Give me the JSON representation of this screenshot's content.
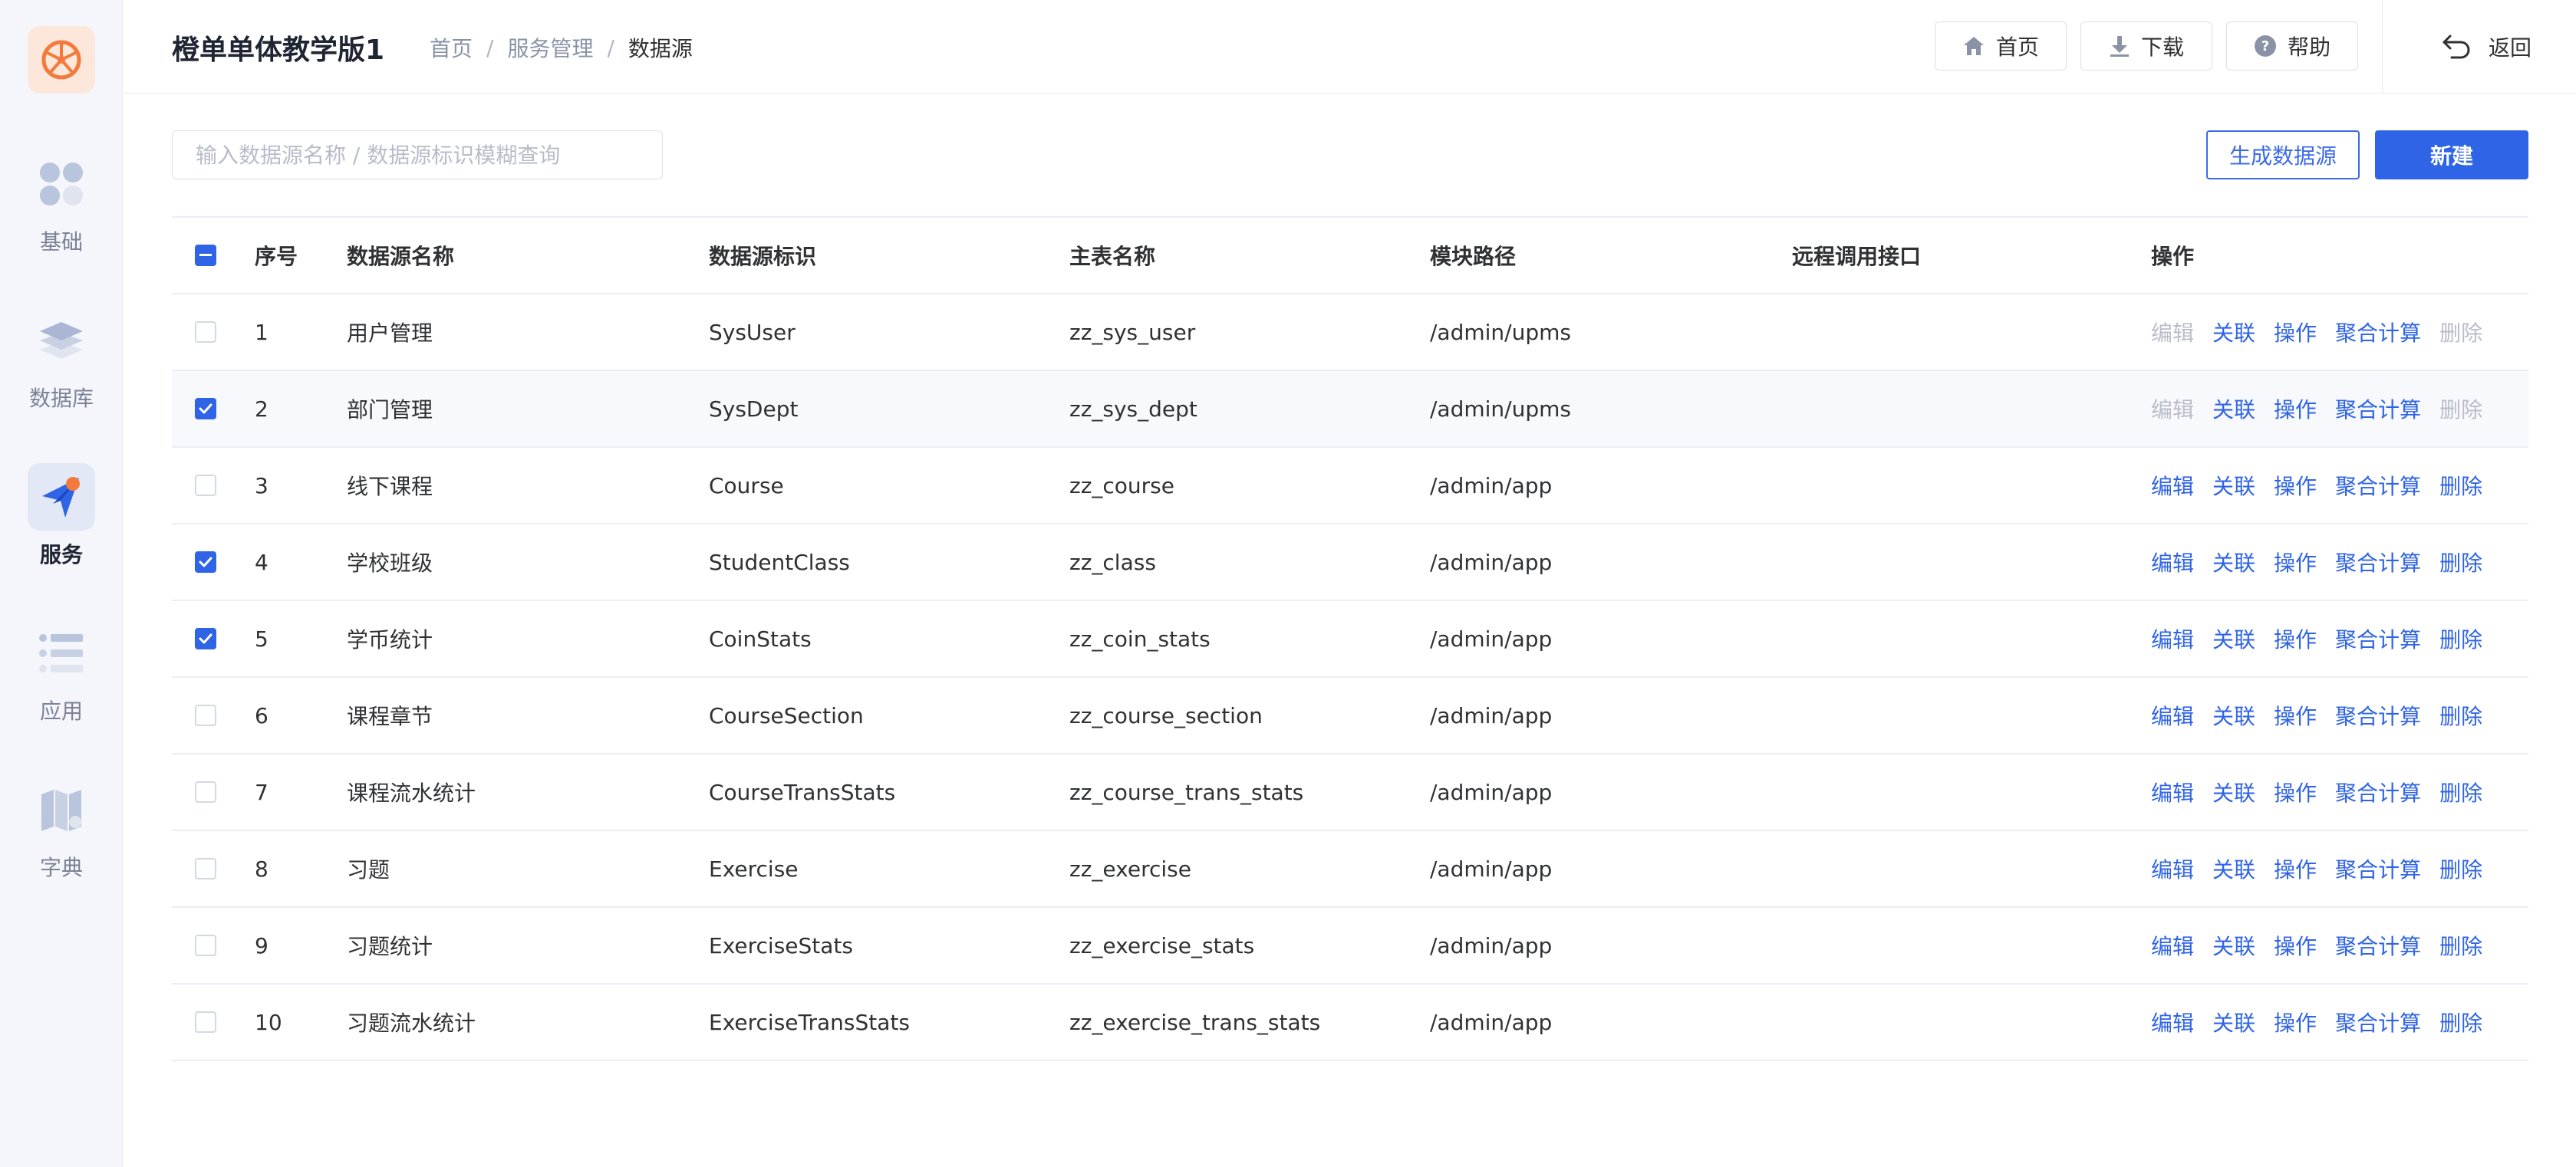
{
  "app": {
    "title": "橙单单体教学版1"
  },
  "breadcrumb": {
    "items": [
      "首页",
      "服务管理"
    ],
    "current": "数据源",
    "separator": "/"
  },
  "header": {
    "home_label": "首页",
    "download_label": "下载",
    "help_label": "帮助",
    "back_label": "返回"
  },
  "sidebar": {
    "items": [
      {
        "label": "基础",
        "icon": "apps-icon",
        "active": false
      },
      {
        "label": "数据库",
        "icon": "layers-icon",
        "active": false
      },
      {
        "label": "服务",
        "icon": "send-icon",
        "active": true
      },
      {
        "label": "应用",
        "icon": "list-icon",
        "active": false
      },
      {
        "label": "字典",
        "icon": "book-icon",
        "active": false
      }
    ]
  },
  "toolbar": {
    "search_placeholder": "输入数据源名称 / 数据源标识模糊查询",
    "search_value": "",
    "generate_label": "生成数据源",
    "new_label": "新建"
  },
  "table": {
    "columns": [
      "序号",
      "数据源名称",
      "数据源标识",
      "主表名称",
      "模块路径",
      "远程调用接口",
      "操作"
    ],
    "header_checkbox": "indeterminate",
    "operations": [
      "编辑",
      "关联",
      "操作",
      "聚合计算",
      "删除"
    ],
    "rows": [
      {
        "index": "1",
        "name": "用户管理",
        "variable": "SysUser",
        "main_table": "zz_sys_user",
        "path": "/admin/upms",
        "rpc": "",
        "checked": false,
        "edit_disabled": true,
        "delete_disabled": true
      },
      {
        "index": "2",
        "name": "部门管理",
        "variable": "SysDept",
        "main_table": "zz_sys_dept",
        "path": "/admin/upms",
        "rpc": "",
        "checked": true,
        "edit_disabled": true,
        "delete_disabled": true
      },
      {
        "index": "3",
        "name": "线下课程",
        "variable": "Course",
        "main_table": "zz_course",
        "path": "/admin/app",
        "rpc": "",
        "checked": false,
        "edit_disabled": false,
        "delete_disabled": false
      },
      {
        "index": "4",
        "name": "学校班级",
        "variable": "StudentClass",
        "main_table": "zz_class",
        "path": "/admin/app",
        "rpc": "",
        "checked": true,
        "edit_disabled": false,
        "delete_disabled": false
      },
      {
        "index": "5",
        "name": "学币统计",
        "variable": "CoinStats",
        "main_table": "zz_coin_stats",
        "path": "/admin/app",
        "rpc": "",
        "checked": true,
        "edit_disabled": false,
        "delete_disabled": false
      },
      {
        "index": "6",
        "name": "课程章节",
        "variable": "CourseSection",
        "main_table": "zz_course_section",
        "path": "/admin/app",
        "rpc": "",
        "checked": false,
        "edit_disabled": false,
        "delete_disabled": false
      },
      {
        "index": "7",
        "name": "课程流水统计",
        "variable": "CourseTransStats",
        "main_table": "zz_course_trans_stats",
        "path": "/admin/app",
        "rpc": "",
        "checked": false,
        "edit_disabled": false,
        "delete_disabled": false
      },
      {
        "index": "8",
        "name": "习题",
        "variable": "Exercise",
        "main_table": "zz_exercise",
        "path": "/admin/app",
        "rpc": "",
        "checked": false,
        "edit_disabled": false,
        "delete_disabled": false
      },
      {
        "index": "9",
        "name": "习题统计",
        "variable": "ExerciseStats",
        "main_table": "zz_exercise_stats",
        "path": "/admin/app",
        "rpc": "",
        "checked": false,
        "edit_disabled": false,
        "delete_disabled": false
      },
      {
        "index": "10",
        "name": "习题流水统计",
        "variable": "ExerciseTransStats",
        "main_table": "zz_exercise_trans_stats",
        "path": "/admin/app",
        "rpc": "",
        "checked": false,
        "edit_disabled": false,
        "delete_disabled": false
      }
    ]
  },
  "colors": {
    "primary": "#2f64e6",
    "logo_orange": "#f37a3c",
    "disabled": "#b8bdc8"
  }
}
